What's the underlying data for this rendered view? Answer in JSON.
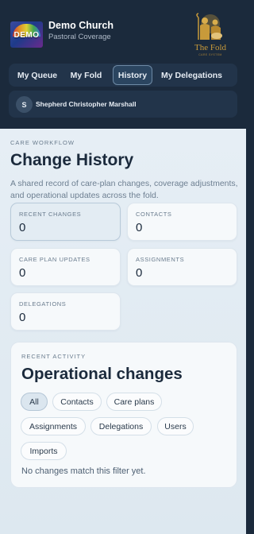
{
  "org": {
    "name": "Demo Church",
    "subtitle": "Pastoral Coverage",
    "logo_text": "DEMO"
  },
  "partner_logo": {
    "title": "The Fold",
    "subtitle": "CARE SYSTEM"
  },
  "nav": {
    "tabs": [
      {
        "label": "My Queue",
        "active": false
      },
      {
        "label": "My Fold",
        "active": false
      },
      {
        "label": "History",
        "active": true
      },
      {
        "label": "My Delegations",
        "active": false
      }
    ]
  },
  "user": {
    "initial": "S",
    "name": "Shepherd Christopher Marshall"
  },
  "page": {
    "eyebrow": "CARE WORKFLOW",
    "title": "Change History",
    "description": "A shared record of care-plan changes, coverage adjustments, and operational updates across the fold."
  },
  "stats": [
    {
      "label": "RECENT CHANGES",
      "value": "0"
    },
    {
      "label": "CONTACTS",
      "value": "0"
    },
    {
      "label": "CARE PLAN UPDATES",
      "value": "0"
    },
    {
      "label": "ASSIGNMENTS",
      "value": "0"
    },
    {
      "label": "DELEGATIONS",
      "value": "0"
    }
  ],
  "activity": {
    "eyebrow": "RECENT ACTIVITY",
    "title": "Operational changes",
    "filters": [
      "All",
      "Contacts",
      "Care plans",
      "Assignments",
      "Delegations",
      "Users",
      "Imports"
    ],
    "active_filter": "All",
    "empty_message": "No changes match this filter yet."
  },
  "colors": {
    "header_bg": "#1b2a3c",
    "content_bg": "#e6eef5",
    "gold": "#c89a3a"
  }
}
